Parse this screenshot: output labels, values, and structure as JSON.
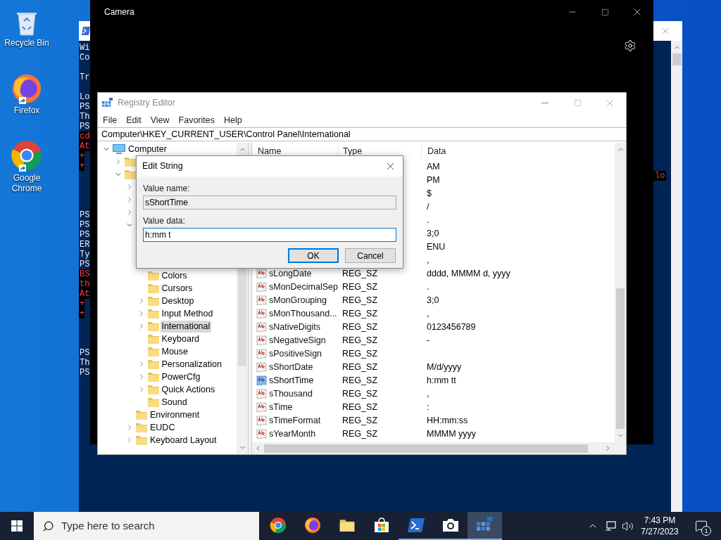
{
  "desktop": {
    "icons": [
      {
        "label": "Recycle Bin",
        "kind": "recycle",
        "shortcut": false
      },
      {
        "label": "Firefox",
        "kind": "firefox",
        "shortcut": true
      },
      {
        "label": "Google Chrome",
        "kind": "chrome",
        "shortcut": true
      }
    ]
  },
  "console": {
    "lines": [
      {
        "kind": "output",
        "text": "Wi"
      },
      {
        "kind": "output",
        "text": "Co"
      },
      {
        "kind": "blank"
      },
      {
        "kind": "output",
        "text": "Tr"
      },
      {
        "kind": "blank"
      },
      {
        "kind": "output",
        "text": "Lo"
      },
      {
        "kind": "output",
        "text": "PS"
      },
      {
        "kind": "output",
        "text": "Th"
      },
      {
        "kind": "output",
        "text": "PS"
      },
      {
        "kind": "error",
        "text": "cd"
      },
      {
        "kind": "error",
        "text": "At"
      },
      {
        "kind": "error",
        "text": "+"
      },
      {
        "kind": "error",
        "text": "+"
      },
      {
        "kind": "error",
        "right_text": "lo"
      },
      {
        "kind": "blank"
      },
      {
        "kind": "blank"
      },
      {
        "kind": "blank"
      },
      {
        "kind": "output",
        "text": "PS"
      },
      {
        "kind": "output",
        "text": "PS"
      },
      {
        "kind": "output",
        "text": "PS"
      },
      {
        "kind": "output",
        "text": "ER"
      },
      {
        "kind": "output",
        "text": "Ty"
      },
      {
        "kind": "output",
        "text": "PS"
      },
      {
        "kind": "error",
        "text": "BS"
      },
      {
        "kind": "error",
        "text": "th"
      },
      {
        "kind": "error",
        "text": "At"
      },
      {
        "kind": "error",
        "text": "+"
      },
      {
        "kind": "error",
        "text": "+"
      },
      {
        "kind": "blank"
      },
      {
        "kind": "blank"
      },
      {
        "kind": "blank"
      },
      {
        "kind": "output",
        "text": "PS"
      },
      {
        "kind": "output",
        "text": "Th"
      },
      {
        "kind": "output",
        "text": "PS"
      }
    ]
  },
  "camera": {
    "title": "Camera"
  },
  "registry": {
    "title": "Registry Editor",
    "menu": [
      "File",
      "Edit",
      "View",
      "Favorites",
      "Help"
    ],
    "address": "Computer\\HKEY_CURRENT_USER\\Control Panel\\International",
    "tree": [
      {
        "label": "Computer",
        "kind": "computer",
        "expanded": true,
        "selected": false,
        "children": [
          {
            "kind": "folder",
            "expanded": false
          },
          {
            "kind": "folder",
            "expanded": true,
            "children": [
              {
                "expanded": false
              },
              {
                "expanded": false
              },
              {
                "expanded": false
              },
              {
                "expanded": true,
                "children": [
                  {
                    "label": "Colors",
                    "kind": "folder",
                    "selected": false
                  },
                  {
                    "label": "Cursors",
                    "kind": "folder",
                    "selected": false
                  },
                  {
                    "label": "Desktop",
                    "kind": "folder",
                    "expanded": false,
                    "selected": false
                  },
                  {
                    "label": "Input Method",
                    "kind": "folder",
                    "expanded": false,
                    "selected": false
                  },
                  {
                    "label": "International",
                    "kind": "folder",
                    "expanded": false,
                    "selected": true
                  },
                  {
                    "label": "Keyboard",
                    "kind": "folder",
                    "selected": false
                  },
                  {
                    "label": "Mouse",
                    "kind": "folder",
                    "selected": false
                  },
                  {
                    "label": "Personalization",
                    "kind": "folder",
                    "expanded": false,
                    "selected": false
                  },
                  {
                    "label": "PowerCfg",
                    "kind": "folder",
                    "expanded": false,
                    "selected": false
                  },
                  {
                    "label": "Quick Actions",
                    "kind": "folder",
                    "expanded": false,
                    "selected": false
                  },
                  {
                    "label": "Sound",
                    "kind": "folder",
                    "selected": false
                  }
                ]
              },
              {
                "label": "Environment",
                "kind": "folder",
                "selected": false
              },
              {
                "label": "EUDC",
                "kind": "folder",
                "expanded": false,
                "selected": false
              },
              {
                "label": "Keyboard Layout",
                "kind": "folder",
                "expanded": false,
                "selected": false
              }
            ]
          }
        ]
      }
    ],
    "columns": [
      "Name",
      "Type",
      "Data"
    ],
    "rows": [
      {
        "data": "AM",
        "selected": false
      },
      {
        "data": "PM",
        "selected": false
      },
      {
        "data": "$",
        "selected": false
      },
      {
        "data": "/",
        "selected": false
      },
      {
        "data": ".",
        "selected": false
      },
      {
        "data": "3;0",
        "selected": false
      },
      {
        "data": "ENU",
        "selected": false
      },
      {
        "data": ",",
        "selected": false
      },
      {
        "name": "sLongDate",
        "type": "REG_SZ",
        "data": "dddd, MMMM d, yyyy",
        "selected": false
      },
      {
        "name": "sMonDecimalSep",
        "type": "REG_SZ",
        "data": ".",
        "selected": false
      },
      {
        "name": "sMonGrouping",
        "type": "REG_SZ",
        "data": "3;0",
        "selected": false
      },
      {
        "name": "sMonThousand...",
        "type": "REG_SZ",
        "data": ",",
        "selected": false
      },
      {
        "name": "sNativeDigits",
        "type": "REG_SZ",
        "data": "0123456789",
        "selected": false
      },
      {
        "name": "sNegativeSign",
        "type": "REG_SZ",
        "data": "-",
        "selected": false
      },
      {
        "name": "sPositiveSign",
        "type": "REG_SZ",
        "selected": false
      },
      {
        "name": "sShortDate",
        "type": "REG_SZ",
        "data": "M/d/yyyy",
        "selected": false
      },
      {
        "name": "sShortTime",
        "type": "REG_SZ",
        "data": "h:mm tt",
        "selected": true
      },
      {
        "name": "sThousand",
        "type": "REG_SZ",
        "data": ",",
        "selected": false
      },
      {
        "name": "sTime",
        "type": "REG_SZ",
        "data": ":",
        "selected": false
      },
      {
        "name": "sTimeFormat",
        "type": "REG_SZ",
        "data": "HH:mm:ss",
        "selected": false
      },
      {
        "name": "sYearMonth",
        "type": "REG_SZ",
        "data": "MMMM yyyy",
        "selected": false
      }
    ]
  },
  "dialog": {
    "title": "Edit String",
    "fields": [
      {
        "label": "Value name:",
        "value": "sShortTime",
        "readonly": true,
        "focused": false
      },
      {
        "label": "Value data:",
        "value": "h:mm t",
        "readonly": false,
        "focused": true
      }
    ],
    "buttons": [
      {
        "label": "OK",
        "default": true
      },
      {
        "label": "Cancel",
        "default": false
      }
    ]
  },
  "taskbar": {
    "search": {
      "placeholder": "Type here to search"
    },
    "apps": [
      {
        "kind": "chrome",
        "running": false,
        "selected": false
      },
      {
        "kind": "firefox",
        "running": false,
        "selected": false
      },
      {
        "kind": "explorer",
        "running": false,
        "selected": false
      },
      {
        "kind": "store",
        "running": false,
        "selected": false
      },
      {
        "kind": "powershell",
        "running": true,
        "selected": false
      },
      {
        "kind": "camera",
        "running": true,
        "selected": false
      },
      {
        "kind": "regedit",
        "running": true,
        "selected": true
      }
    ],
    "time": "7:43 PM",
    "date": "7/27/2023",
    "notifications": "1"
  }
}
